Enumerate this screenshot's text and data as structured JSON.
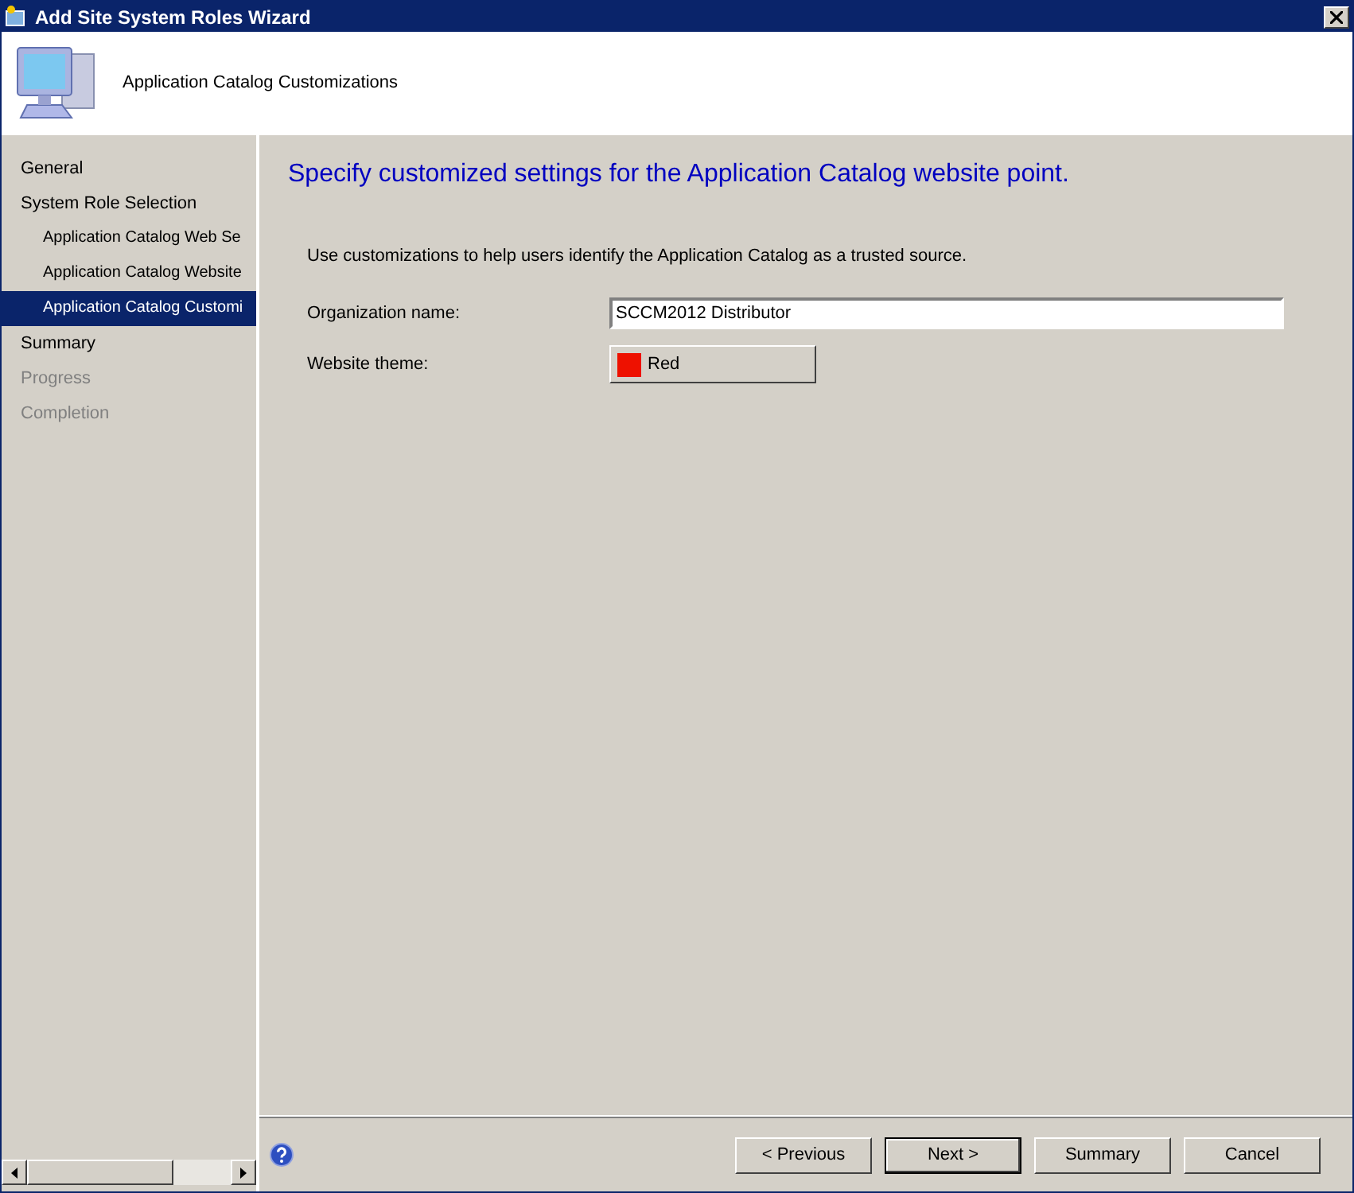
{
  "window": {
    "title": "Add Site System Roles Wizard"
  },
  "header": {
    "title": "Application Catalog Customizations"
  },
  "sidebar": {
    "items": [
      {
        "label": "General",
        "selected": false,
        "disabled": false
      },
      {
        "label": "System Role Selection",
        "selected": false,
        "disabled": false,
        "children": [
          {
            "label": "Application Catalog Web Se",
            "selected": false,
            "disabled": false
          },
          {
            "label": "Application Catalog Website",
            "selected": false,
            "disabled": false
          },
          {
            "label": "Application Catalog Customi",
            "selected": true,
            "disabled": false
          }
        ]
      },
      {
        "label": "Summary",
        "selected": false,
        "disabled": false
      },
      {
        "label": "Progress",
        "selected": false,
        "disabled": true
      },
      {
        "label": "Completion",
        "selected": false,
        "disabled": true
      }
    ]
  },
  "content": {
    "heading": "Specify customized settings for the Application Catalog website point.",
    "description": "Use customizations to help users identify the Application Catalog as a trusted source.",
    "organization_name": {
      "label": "Organization name:",
      "value": "SCCM2012 Distributor"
    },
    "website_theme": {
      "label": "Website theme:",
      "value": "Red",
      "color": "#ee1100"
    }
  },
  "buttons": [
    {
      "label": "< Previous",
      "default": false
    },
    {
      "label": "Next >",
      "default": true
    },
    {
      "label": "Summary",
      "default": false
    },
    {
      "label": "Cancel",
      "default": false
    }
  ]
}
